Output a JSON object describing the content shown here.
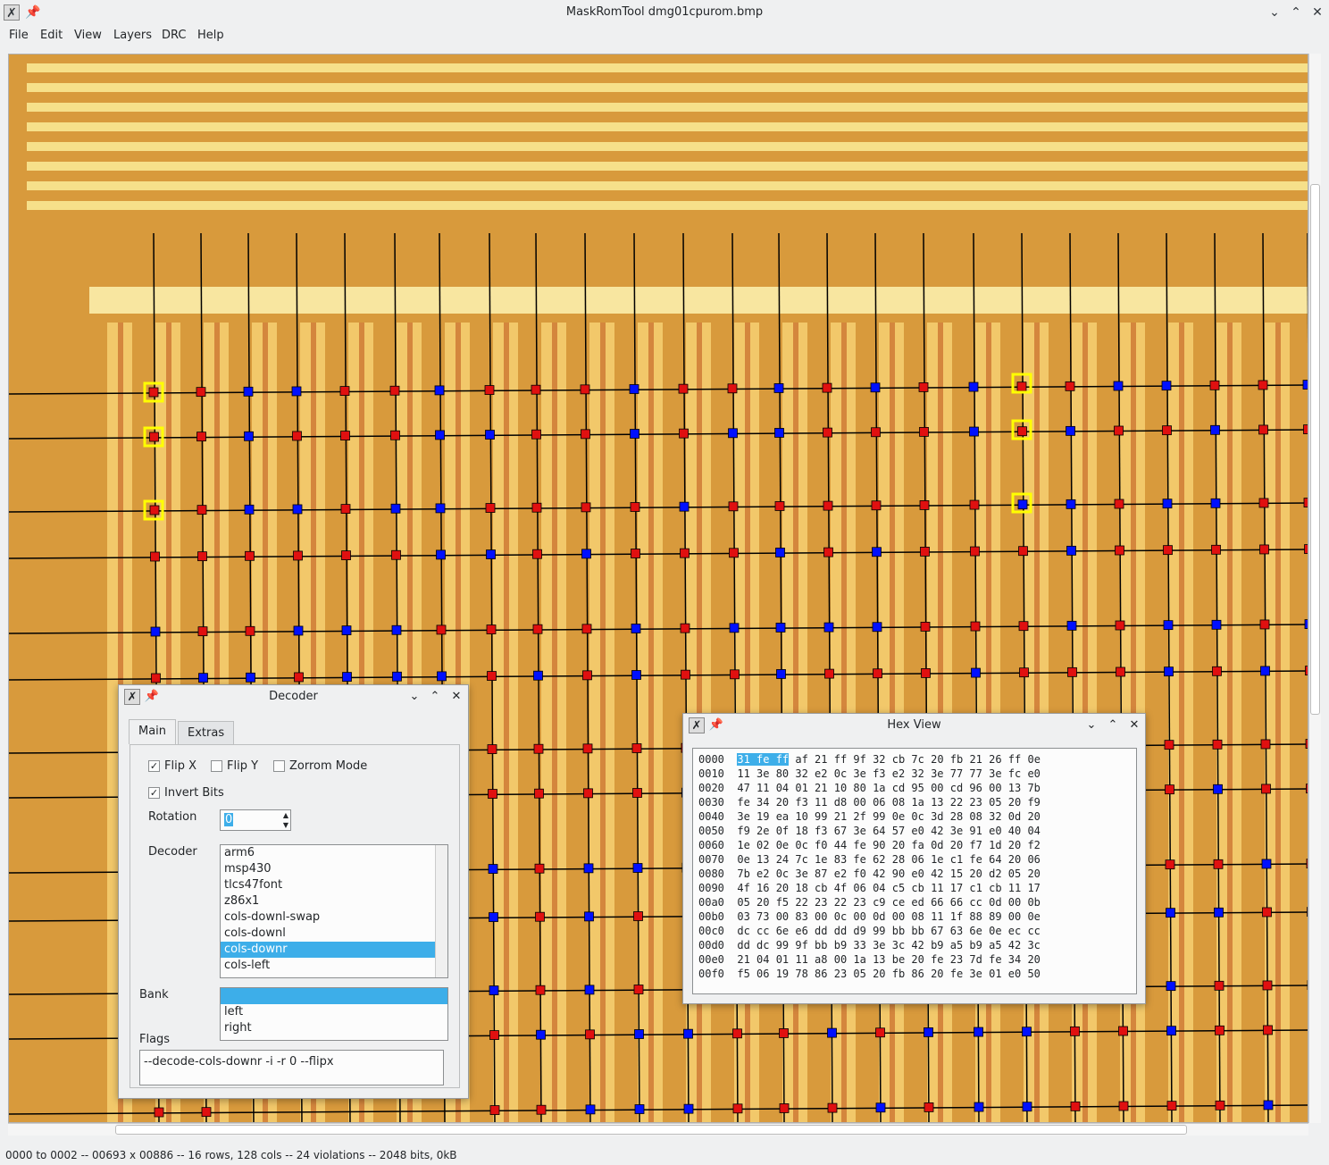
{
  "window": {
    "title": "MaskRomTool dmg01cpurom.bmp"
  },
  "menu": [
    "File",
    "Edit",
    "View",
    "Layers",
    "DRC",
    "Help"
  ],
  "status": "0000 to 0002 -- 00693 x 00886 -- 16 rows, 128 cols -- 24 violations -- 2048 bits, 0kB",
  "decoder_dialog": {
    "title": "Decoder",
    "tabs": [
      "Main",
      "Extras"
    ],
    "flip_x": "Flip X",
    "flip_y": "Flip Y",
    "zorrom": "Zorrom Mode",
    "invert": "Invert Bits",
    "rotation_label": "Rotation",
    "rotation_value": "0",
    "decoder_label": "Decoder",
    "decoders": [
      "arm6",
      "msp430",
      "tlcs47font",
      "z86x1",
      "cols-downl-swap",
      "cols-downl",
      "cols-downr",
      "cols-left"
    ],
    "selected_decoder": "cols-downr",
    "bank_label": "Bank",
    "banks": [
      "",
      "left",
      "right"
    ],
    "flags_label": "Flags",
    "flags_value": "--decode-cols-downr -i -r 0 --flipx"
  },
  "hex_dialog": {
    "title": "Hex View",
    "selected": "31 fe ff",
    "first_rest": " af 21 ff 9f 32 cb 7c 20 fb 21 26 ff 0e",
    "rows": [
      "0010  11 3e 80 32 e2 0c 3e f3 e2 32 3e 77 77 3e fc e0",
      "0020  47 11 04 01 21 10 80 1a cd 95 00 cd 96 00 13 7b",
      "0030  fe 34 20 f3 11 d8 00 06 08 1a 13 22 23 05 20 f9",
      "0040  3e 19 ea 10 99 21 2f 99 0e 0c 3d 28 08 32 0d 20",
      "0050  f9 2e 0f 18 f3 67 3e 64 57 e0 42 3e 91 e0 40 04",
      "0060  1e 02 0e 0c f0 44 fe 90 20 fa 0d 20 f7 1d 20 f2",
      "0070  0e 13 24 7c 1e 83 fe 62 28 06 1e c1 fe 64 20 06",
      "0080  7b e2 0c 3e 87 e2 f0 42 90 e0 42 15 20 d2 05 20",
      "0090  4f 16 20 18 cb 4f 06 04 c5 cb 11 17 c1 cb 11 17",
      "00a0  05 20 f5 22 23 22 23 c9 ce ed 66 66 cc 0d 00 0b",
      "00b0  03 73 00 83 00 0c 00 0d 00 08 11 1f 88 89 00 0e",
      "00c0  dc cc 6e e6 dd dd d9 99 bb bb 67 63 6e 0e ec cc",
      "00d0  dd dc 99 9f bb b9 33 3e 3c 42 b9 a5 b9 a5 42 3c",
      "00e0  21 04 01 11 a8 00 1a 13 be 20 fe 23 7d fe 34 20",
      "00f0  f5 06 19 78 86 23 05 20 fb 86 20 fe 3e 01 e0 50"
    ],
    "first_addr": "0000"
  },
  "colors": {
    "bit_on": "#0010ff",
    "bit_off": "#e01010",
    "select": "#ffff00",
    "die": "#e0a040"
  }
}
